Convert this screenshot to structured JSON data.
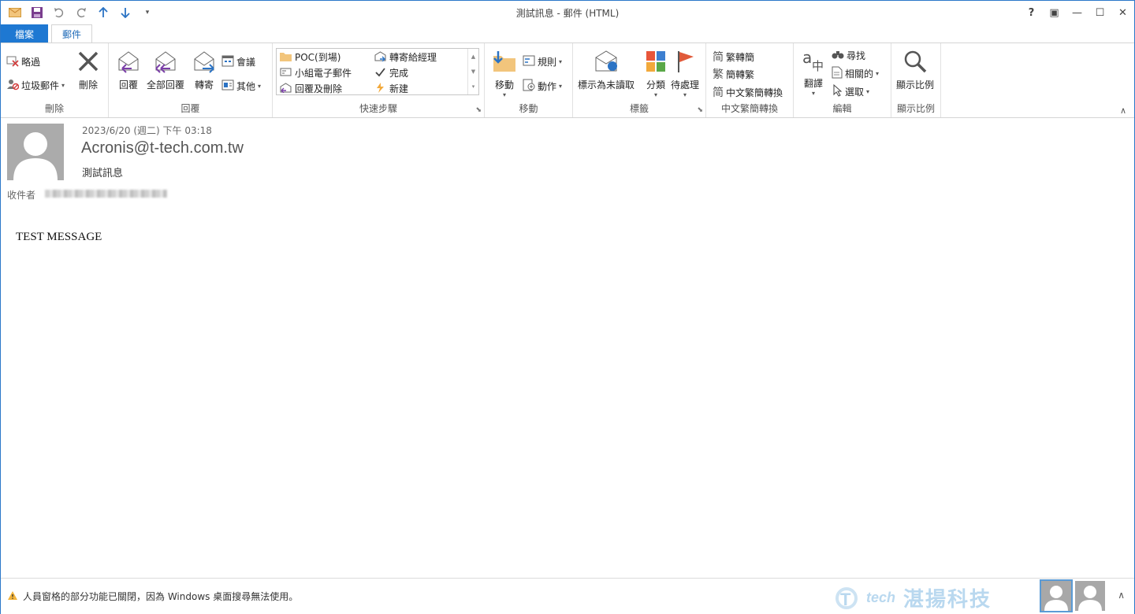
{
  "window": {
    "title": "測試訊息 - 郵件 (HTML)",
    "controls": [
      "?",
      "▣",
      "—",
      "☐",
      "✕"
    ]
  },
  "tabs": {
    "file": "檔案",
    "mail": "郵件"
  },
  "ribbon": {
    "delete_group": {
      "label": "刪除",
      "ignore": "略過",
      "junk": "垃圾郵件",
      "delete": "刪除"
    },
    "respond_group": {
      "label": "回覆",
      "reply": "回覆",
      "reply_all": "全部回覆",
      "forward": "轉寄",
      "meeting": "會議",
      "more": "其他"
    },
    "quicksteps_group": {
      "label": "快速步驟",
      "items": [
        "POC(到場)",
        "轉寄給經理",
        "小組電子郵件",
        "完成",
        "回覆及刪除",
        "新建"
      ]
    },
    "move_group": {
      "label": "移動",
      "move": "移動",
      "rules": "規則",
      "actions": "動作"
    },
    "tags_group": {
      "label": "標籤",
      "mark_unread": "標示為未讀取",
      "categorize": "分類",
      "followup": "待處理"
    },
    "chinese_group": {
      "label": "中文繁簡轉換",
      "to_simplified": "繁轉簡",
      "to_traditional": "簡轉繁",
      "convert": "中文繁簡轉換"
    },
    "editing_group": {
      "label": "編輯",
      "translate": "翻譯",
      "find": "尋找",
      "related": "相關的",
      "select": "選取"
    },
    "zoom_group": {
      "label": "顯示比例",
      "zoom": "顯示比例"
    }
  },
  "message": {
    "date": "2023/6/20 (週二) 下午 03:18",
    "sender": "Acronis@t-tech.com.tw",
    "subject": "測試訊息",
    "to_label": "收件者",
    "body": "TEST MESSAGE"
  },
  "statusbar": {
    "message": "人員窗格的部分功能已關閉，因為 Windows 桌面搜尋無法使用。",
    "watermark_latin": "tech",
    "watermark_cn": "湛揚科技"
  },
  "colors": {
    "accent": "#1e78d2",
    "flag": "#e05a3a",
    "tile1": "#e8563a",
    "tile2": "#3d7fd0",
    "tile3": "#f2a93b",
    "tile4": "#5aa848"
  }
}
